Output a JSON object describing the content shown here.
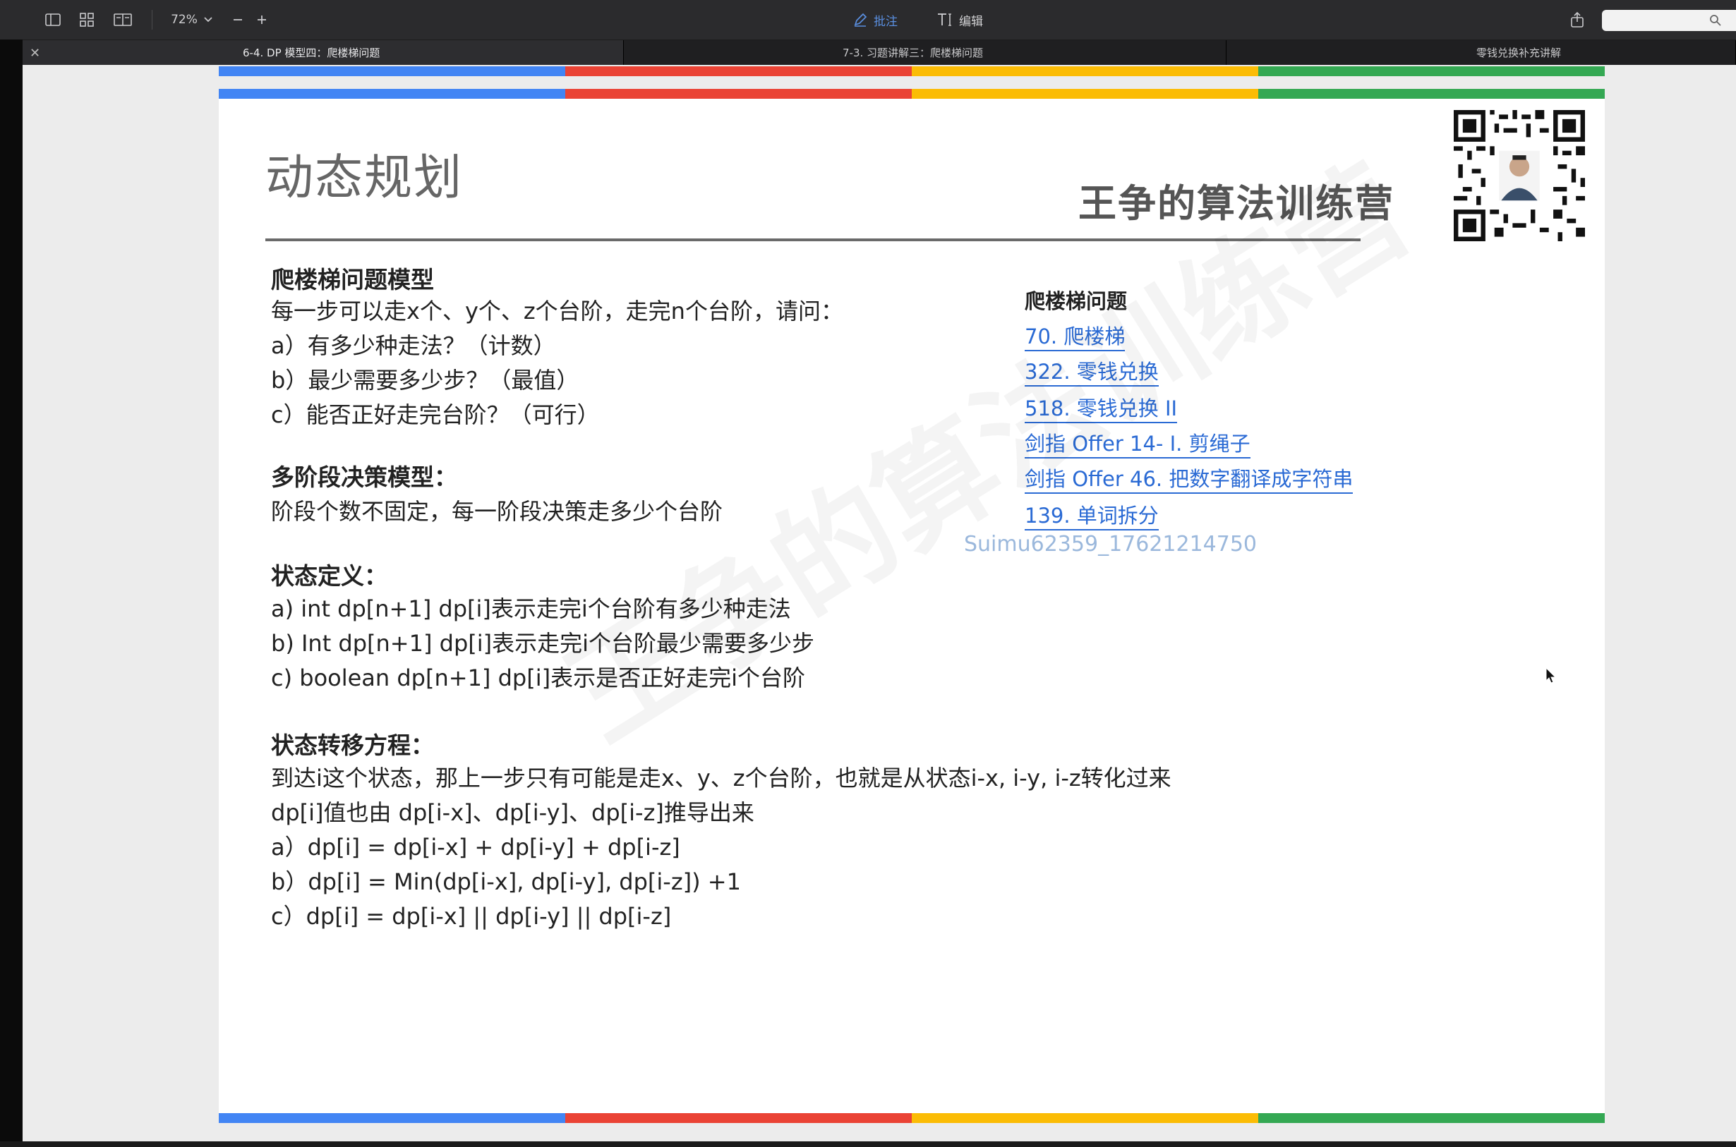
{
  "toolbar": {
    "zoom_value": "72%",
    "annotate_label": "批注",
    "edit_label": "编辑",
    "search_placeholder": ""
  },
  "tabs": [
    {
      "label": "6-4. DP 模型四：爬楼梯问题"
    },
    {
      "label": "7-3. 习题讲解三：爬楼梯问题"
    },
    {
      "label": "零钱兑换补充讲解"
    }
  ],
  "slide": {
    "title": "动态规划",
    "brand": "王争的算法训练营",
    "stripe_colors": [
      "#4285f4",
      "#ea4335",
      "#fbbc05",
      "#34a853"
    ],
    "sections": {
      "model": {
        "heading": "爬楼梯问题模型",
        "lines": [
          "每一步可以走x个、y个、z个台阶，走完n个台阶，请问：",
          "a）有多少种走法？（计数）",
          "b）最少需要多少步？（最值）",
          "c）能否正好走完台阶？（可行）"
        ]
      },
      "multistage": {
        "heading": "多阶段决策模型：",
        "lines": [
          "阶段个数不固定，每一阶段决策走多少个台阶"
        ]
      },
      "state": {
        "heading": "状态定义：",
        "lines": [
          "a)   int dp[n+1]  dp[i]表示走完i个台阶有多少种走法",
          "b)   Int dp[n+1]  dp[i]表示走完i个台阶最少需要多少步",
          "c)   boolean dp[n+1]  dp[i]表示是否正好走完i个台阶"
        ]
      },
      "transition": {
        "heading": "状态转移方程：",
        "lines": [
          "到达i这个状态，那上一步只有可能是走x、y、z个台阶，也就是从状态i-x, i-y, i-z转化过来",
          "dp[i]值也由 dp[i-x]、dp[i-y]、dp[i-z]推导出来",
          "a）dp[i] = dp[i-x] + dp[i-y] + dp[i-z]",
          "b）dp[i] = Min(dp[i-x], dp[i-y], dp[i-z]) +1",
          "c）dp[i] = dp[i-x] || dp[i-y] || dp[i-z]"
        ]
      }
    },
    "links_title": "爬楼梯问题",
    "links": [
      "70. 爬楼梯",
      "322. 零钱兑换",
      "518. 零钱兑换 II",
      "剑指 Offer 14- I. 剪绳子",
      "剑指 Offer 46. 把数字翻译成字符串",
      "139. 单词拆分"
    ],
    "watermark_id": "Suimu62359_17621214750",
    "watermark_text": "王争的算法训练营"
  }
}
